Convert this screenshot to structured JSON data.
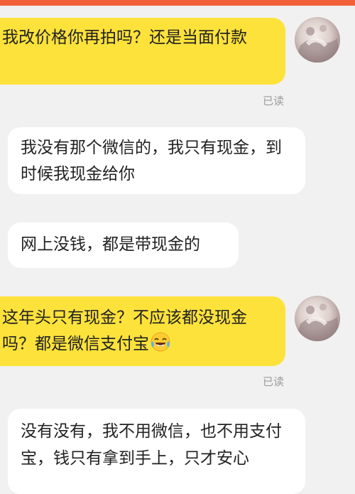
{
  "messages": [
    {
      "side": "mine",
      "text": "我改价格你再拍吗？还是当面付款",
      "status": "已读"
    },
    {
      "side": "theirs",
      "text": "我没有那个微信的，我只有现金，到时候我现金给你"
    },
    {
      "side": "theirs",
      "text": "网上没钱，都是带现金的"
    },
    {
      "side": "mine",
      "text": "这年头只有现金？不应该都没现金吗？都是微信支付宝",
      "emoji": "tears-of-joy-emoji",
      "status": "已读"
    },
    {
      "side": "theirs",
      "text": "没有没有，我不用微信，也不用支付宝，钱只有拿到手上，只才安心"
    }
  ],
  "colors": {
    "top_bar": "#f2603a",
    "mine_bubble": "#fde23b",
    "theirs_bubble": "#ffffff",
    "background": "#f1f1f1",
    "read_status": "#9b9b9b"
  }
}
